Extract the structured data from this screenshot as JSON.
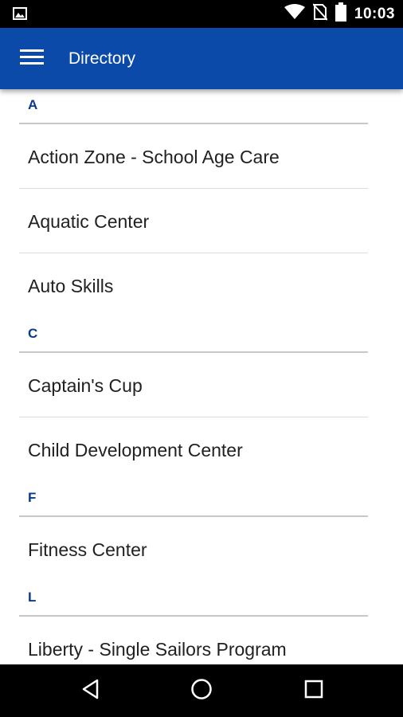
{
  "status_bar": {
    "time": "10:03",
    "icons": [
      "image-notification-icon",
      "wifi-icon",
      "no-sim-icon",
      "battery-icon"
    ]
  },
  "app_bar": {
    "title": "Directory",
    "menu_icon": "hamburger-menu-icon",
    "background": "#0b4aa8"
  },
  "directory": {
    "sections": [
      {
        "letter": "A",
        "items": [
          "Action Zone - School Age Care",
          "Aquatic Center",
          "Auto Skills"
        ]
      },
      {
        "letter": "C",
        "items": [
          "Captain's Cup",
          "Child Development Center"
        ]
      },
      {
        "letter": "F",
        "items": [
          "Fitness Center"
        ]
      },
      {
        "letter": "L",
        "items": [
          "Liberty - Single Sailors Program"
        ]
      }
    ],
    "header_color": "#0b3a8c"
  },
  "nav_bar": {
    "icons": [
      "back-icon",
      "home-icon",
      "recents-icon"
    ]
  }
}
